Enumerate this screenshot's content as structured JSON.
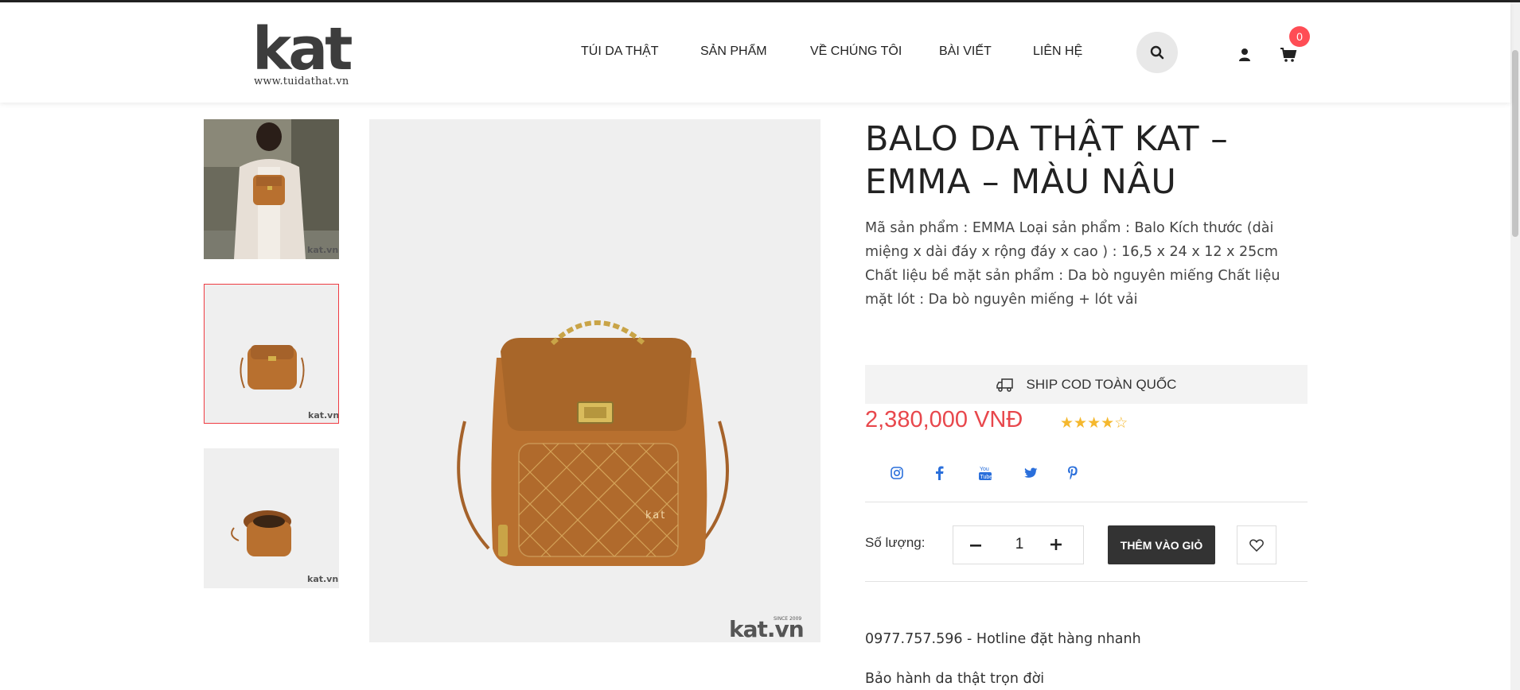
{
  "header": {
    "logo_text": "kat",
    "logo_url_text": "www.tuidathat.vn",
    "nav": [
      {
        "label": "TÚI DA THẬT"
      },
      {
        "label": "SẢN PHẨM"
      },
      {
        "label": "VỀ CHÚNG TÔI"
      },
      {
        "label": "BÀI VIẾT"
      },
      {
        "label": "LIÊN HỆ"
      }
    ],
    "cart_count": "0"
  },
  "gallery": {
    "thumb_watermark": "kat.vn",
    "main_watermark": "kat.vn",
    "main_watermark_since": "SINCE 2009"
  },
  "product": {
    "title": "BALO DA THẬT KAT – EMMA – MÀU NÂU",
    "description": "Mã sản phẩm : EMMA Loại sản phẩm : Balo Kích thước (dài miệng x dài đáy x rộng đáy x cao ) : 16,5 x 24 x 12 x 25cm Chất liệu bề mặt sản phẩm : Da bò nguyên miếng Chất liệu mặt lót : Da bò nguyên miếng + lót vải",
    "ship_text": "SHIP COD TOÀN QUỐC",
    "price": "2,380,000 VNĐ",
    "rating": 4,
    "rating_max": 5,
    "quantity_label": "Số lượng:",
    "quantity": "1",
    "add_to_cart": "THÊM VÀO GIỎ",
    "hotline": "0977.757.596 - Hotline đặt hàng nhanh",
    "warranty": "Bảo hành da thật trọn đời"
  },
  "colors": {
    "accent": "#e8474c",
    "badge": "#ff4d55",
    "star": "#f5b82e",
    "social": "#2a6fdb",
    "leather": "#b8702f"
  }
}
